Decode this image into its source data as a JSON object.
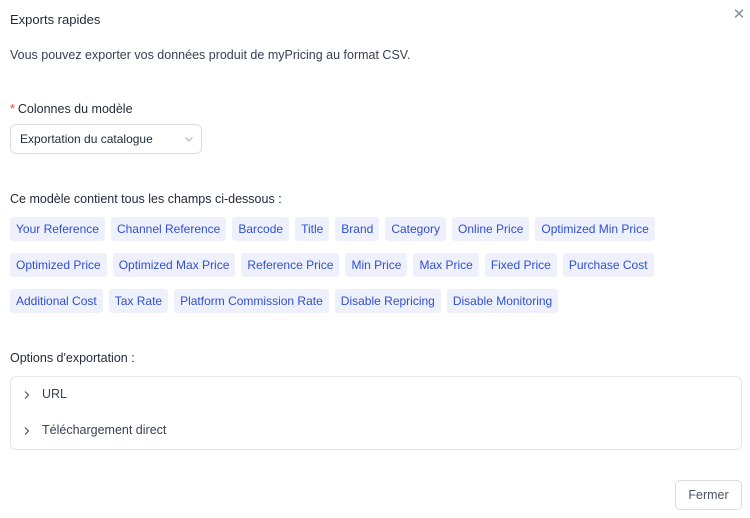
{
  "modal": {
    "title": "Exports rapides",
    "close_icon": "close-icon",
    "description": "Vous pouvez exporter vos données produit de myPricing au format CSV."
  },
  "template_field": {
    "required_mark": "*",
    "label": "Colonnes du modèle",
    "selected_value": "Exportation du catalogue",
    "chevron_icon": "chevron-down-icon"
  },
  "fields_section": {
    "label": "Ce modèle contient tous les champs ci-dessous :",
    "rows": [
      [
        "Your Reference",
        "Channel Reference",
        "Barcode",
        "Title",
        "Brand",
        "Category",
        "Online Price",
        "Optimized Min Price"
      ],
      [
        "Optimized Price",
        "Optimized Max Price",
        "Reference Price",
        "Min Price",
        "Max Price",
        "Fixed Price",
        "Purchase Cost"
      ],
      [
        "Additional Cost",
        "Tax Rate",
        "Platform Commission Rate",
        "Disable Repricing",
        "Disable Monitoring"
      ]
    ]
  },
  "export_options": {
    "label": "Options d'exportation :",
    "items": [
      {
        "label": "URL",
        "icon": "chevron-right-icon"
      },
      {
        "label": "Téléchargement direct",
        "icon": "chevron-right-icon"
      }
    ]
  },
  "footer": {
    "close_button": "Fermer"
  },
  "colors": {
    "tag_background": "#eef1fb",
    "tag_text": "#2f4fd3",
    "required": "#ef4444",
    "border": "#d9dde3"
  }
}
